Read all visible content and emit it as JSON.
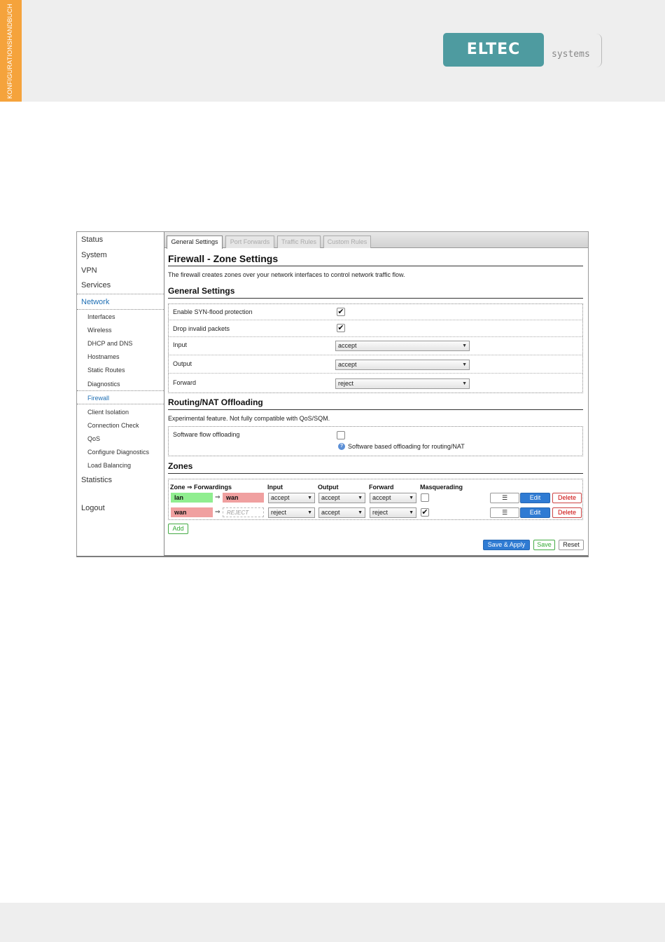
{
  "document": {
    "side_tab": "KONFIGURATIONSHANDBUCH",
    "logo": {
      "brand": "ELTEC",
      "sub": "systems",
      "brand_color": "#4e9ba0"
    }
  },
  "sidebar": {
    "items": [
      {
        "label": "Status"
      },
      {
        "label": "System"
      },
      {
        "label": "VPN"
      },
      {
        "label": "Services"
      },
      {
        "label": "Network",
        "active": true
      },
      {
        "label": "Statistics"
      },
      {
        "label": "Logout"
      }
    ],
    "network_sub": [
      {
        "label": "Interfaces"
      },
      {
        "label": "Wireless"
      },
      {
        "label": "DHCP and DNS"
      },
      {
        "label": "Hostnames"
      },
      {
        "label": "Static Routes"
      },
      {
        "label": "Diagnostics"
      },
      {
        "label": "Firewall",
        "active": true
      },
      {
        "label": "Client Isolation"
      },
      {
        "label": "Connection Check"
      },
      {
        "label": "QoS"
      },
      {
        "label": "Configure Diagnostics"
      },
      {
        "label": "Load Balancing"
      }
    ]
  },
  "tabs": [
    {
      "label": "General Settings",
      "active": true
    },
    {
      "label": "Port Forwards"
    },
    {
      "label": "Traffic Rules"
    },
    {
      "label": "Custom Rules"
    }
  ],
  "page": {
    "title": "Firewall - Zone Settings",
    "description": "The firewall creates zones over your network interfaces to control network traffic flow."
  },
  "general": {
    "heading": "General Settings",
    "syn_label": "Enable SYN-flood protection",
    "syn_checked": true,
    "drop_label": "Drop invalid packets",
    "drop_checked": true,
    "input_label": "Input",
    "input_value": "accept",
    "output_label": "Output",
    "output_value": "accept",
    "forward_label": "Forward",
    "forward_value": "reject"
  },
  "offload": {
    "heading": "Routing/NAT Offloading",
    "description": "Experimental feature. Not fully compatible with QoS/SQM.",
    "label": "Software flow offloading",
    "checked": false,
    "hint": "Software based offloading for routing/NAT"
  },
  "zones": {
    "heading": "Zones",
    "headers": {
      "zone": "Zone ⇒ Forwardings",
      "input": "Input",
      "output": "Output",
      "forward": "Forward",
      "masq": "Masquerading"
    },
    "rows": [
      {
        "zone": "lan",
        "arrow": "⇒",
        "target": "wan",
        "input": "accept",
        "output": "accept",
        "forward": "accept",
        "masq": false,
        "menu": "☰",
        "edit": "Edit",
        "delete": "Delete"
      },
      {
        "zone": "wan",
        "arrow": "⇒",
        "target": "REJECT",
        "input": "reject",
        "output": "accept",
        "forward": "reject",
        "masq": true,
        "menu": "☰",
        "edit": "Edit",
        "delete": "Delete"
      }
    ],
    "add_label": "Add"
  },
  "footer_buttons": {
    "save_apply": "Save & Apply",
    "save": "Save",
    "reset": "Reset"
  }
}
